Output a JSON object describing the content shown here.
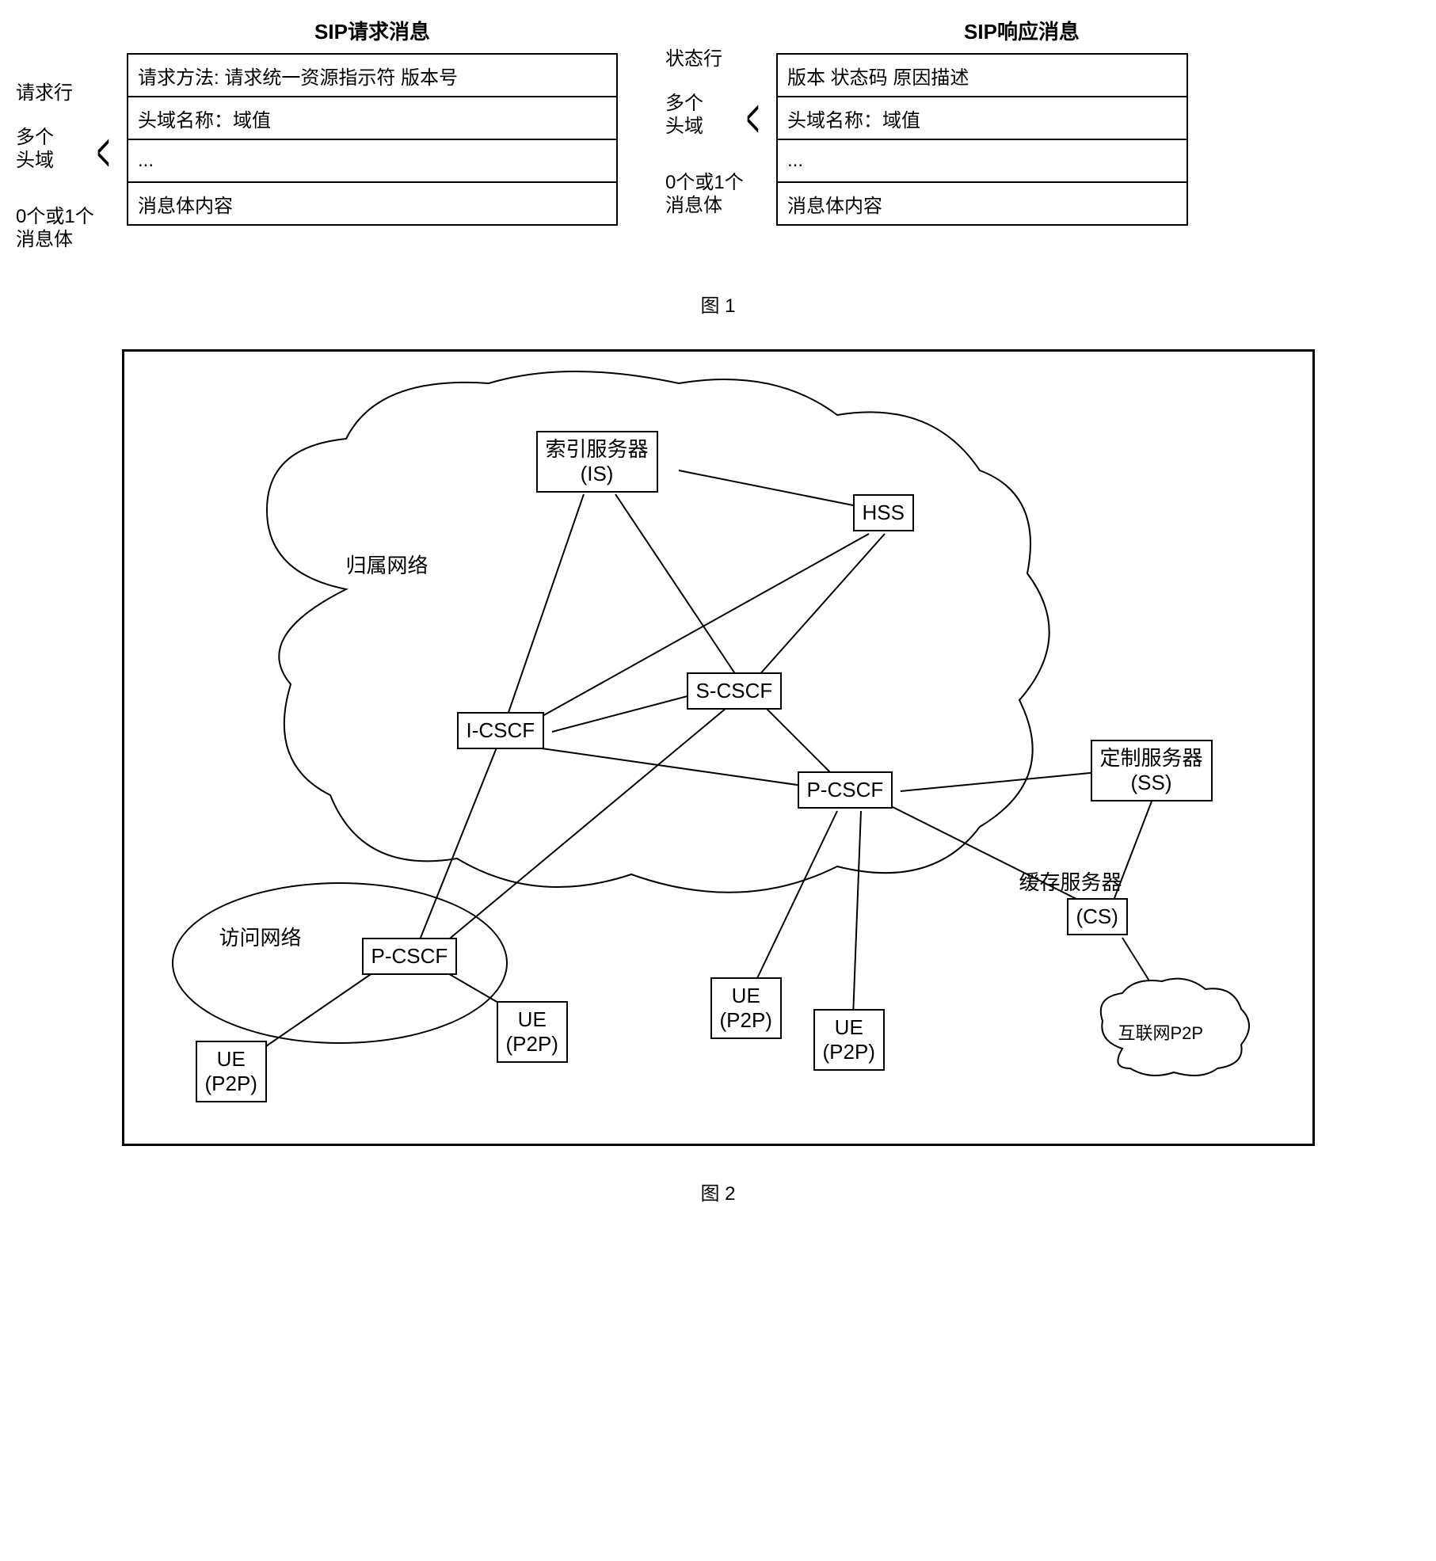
{
  "fig1": {
    "request": {
      "title": "SIP请求消息",
      "labels": {
        "row1": "请求行",
        "row2a": "多个",
        "row2b": "头域",
        "row3a": "0个或1个",
        "row3b": "消息体"
      },
      "rows": {
        "r1": "请求方法: 请求统一资源指示符 版本号",
        "r2": "头域名称：域值",
        "r3": "...",
        "r4": "消息体内容"
      }
    },
    "response": {
      "title": "SIP响应消息",
      "labels": {
        "row1": "状态行",
        "row2a": "多个",
        "row2b": "头域",
        "row3a": "0个或1个",
        "row3b": "消息体"
      },
      "rows": {
        "r1": "版本 状态码 原因描述",
        "r2": "头域名称：域值",
        "r3": "...",
        "r4": "消息体内容"
      }
    },
    "caption": "图 1"
  },
  "fig2": {
    "home_network": "归属网络",
    "visited_network": "访问网络",
    "nodes": {
      "is": "索引服务器\n(IS)",
      "hss": "HSS",
      "scscf": "S-CSCF",
      "icscf": "I-CSCF",
      "pcscf_home": "P-CSCF",
      "pcscf_visited": "P-CSCF",
      "ss": "定制服务器\n(SS)",
      "cs_label": "缓存服务器",
      "cs": "(CS)",
      "ue1": "UE\n(P2P)",
      "ue2": "UE\n(P2P)",
      "ue3": "UE\n(P2P)",
      "ue4": "UE\n(P2P)",
      "internet": "互联网P2P"
    },
    "caption": "图 2"
  }
}
